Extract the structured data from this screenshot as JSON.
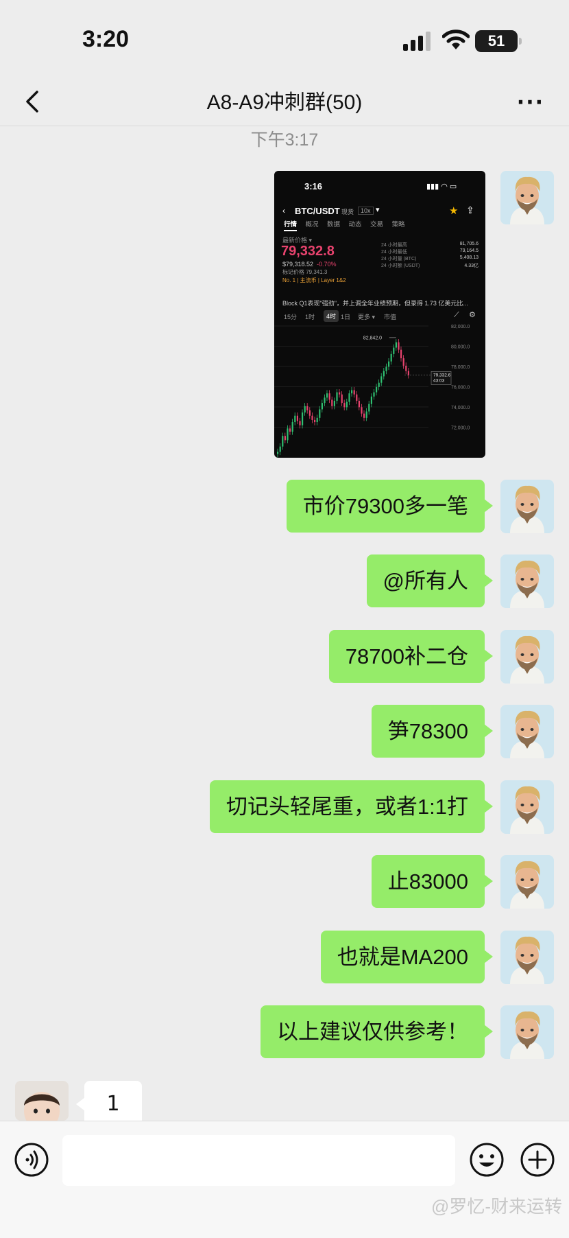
{
  "status": {
    "time": "3:20",
    "battery": "51"
  },
  "nav": {
    "title": "A8-A9冲刺群(50)",
    "more": "···"
  },
  "chat": {
    "timestamp": "下午3:17"
  },
  "shared_image": {
    "time": "3:16",
    "pair": "BTC/USDT",
    "tag_spot": "现货",
    "tag_lev": "10x",
    "tabs": [
      "行情",
      "概况",
      "数据",
      "动态",
      "交易",
      "策略"
    ],
    "latest_label": "最新价格 ▾",
    "price": "79,332.8",
    "usd_value": "$79,318.52",
    "change": "-0.70%",
    "mark_price": "标记价格 79,341.3",
    "rank": "No. 1 | 主流币 | Layer 1&2",
    "stats": [
      {
        "label": "24 小时最高",
        "value": "81,705.6"
      },
      {
        "label": "24 小时最低",
        "value": "79,164.5"
      },
      {
        "label": "24 小时量 (BTC)",
        "value": "5,408.13"
      },
      {
        "label": "24 小时额 (USDT)",
        "value": "4.33亿"
      }
    ],
    "news": "Block Q1表现\"强劲\"，并上调全年业绩预期，但录得 1.73 亿美元比...",
    "intervals": [
      "15分",
      "1时",
      "4时",
      "1日",
      "更多 ▾",
      "市值"
    ],
    "high_marker": "82,842.0",
    "last_price_box": [
      "79,332.6",
      "43:03"
    ],
    "y_ticks": [
      "82,000.0",
      "80,000.0",
      "78,000.0",
      "76,000.0",
      "74,000.0",
      "72,000.0"
    ]
  },
  "messages": [
    {
      "text": "市价79300多一笔"
    },
    {
      "text": "@所有人"
    },
    {
      "text": "78700补二仓"
    },
    {
      "text": "笋78300"
    },
    {
      "text": "切记头轻尾重，或者1:1打"
    },
    {
      "text": "止83000"
    },
    {
      "text": "也就是MA200"
    },
    {
      "text": "以上建议仅供参考！"
    }
  ],
  "incoming": {
    "text": "1"
  },
  "watermark": "@罗忆-财来运转",
  "colors": {
    "bubble": "#95ec69",
    "bg": "#ededed",
    "price_pink": "#e8436e"
  }
}
